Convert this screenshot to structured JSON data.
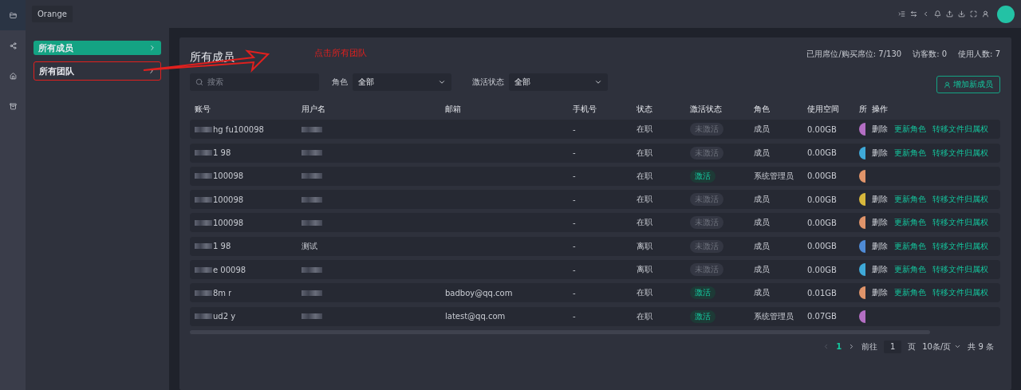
{
  "topbar": {
    "workspace": "Orange"
  },
  "sidebar": {
    "items": [
      {
        "label": "所有成员",
        "selected": true
      },
      {
        "label": "所有团队",
        "selected": false
      }
    ]
  },
  "annotation": {
    "text": "点击所有团队"
  },
  "panel": {
    "title": "所有成员",
    "stats": [
      "已用席位/购买席位: 7/130",
      "访客数: 0",
      "使用人数: 7"
    ],
    "filters": {
      "search_placeholder": "搜索",
      "role_label": "角色",
      "role_value": "全部",
      "activation_label": "激活状态",
      "activation_value": "全部"
    },
    "add_button": "增加新成员"
  },
  "table": {
    "columns": [
      "账号",
      "用户名",
      "邮箱",
      "手机号",
      "状态",
      "激活状态",
      "角色",
      "使用空间",
      "所",
      "操作"
    ],
    "rows": [
      {
        "account": "hg fu100098",
        "username": "",
        "email": "",
        "phone": "-",
        "status": "在职",
        "activation": "未激活",
        "activated": false,
        "role": "成员",
        "space": "0.00GB",
        "color": "#b46fc4",
        "actions": [
          "删除",
          "更新角色",
          "转移文件归属权"
        ]
      },
      {
        "account": "1 98",
        "username": "",
        "email": "",
        "phone": "-",
        "status": "在职",
        "activation": "未激活",
        "activated": false,
        "role": "成员",
        "space": "0.00GB",
        "color": "#3fa9d8",
        "actions": [
          "删除",
          "更新角色",
          "转移文件归属权"
        ]
      },
      {
        "account": "100098",
        "username": "",
        "email": "",
        "phone": "-",
        "status": "在职",
        "activation": "激活",
        "activated": true,
        "role": "系统管理员",
        "space": "0.00GB",
        "color": "#e0946a"
      },
      {
        "account": "100098",
        "username": "",
        "email": "",
        "phone": "-",
        "status": "在职",
        "activation": "未激活",
        "activated": false,
        "role": "成员",
        "space": "0.00GB",
        "color": "#d8b83c",
        "actions": [
          "删除",
          "更新角色",
          "转移文件归属权"
        ]
      },
      {
        "account": "100098",
        "username": "",
        "email": "",
        "phone": "-",
        "status": "在职",
        "activation": "未激活",
        "activated": false,
        "role": "成员",
        "space": "0.00GB",
        "color": "#e0946a",
        "actions": [
          "删除",
          "更新角色",
          "转移文件归属权"
        ]
      },
      {
        "account": "1 98",
        "username": "测试",
        "email": "",
        "phone": "-",
        "status": "离职",
        "activation": "未激活",
        "activated": false,
        "role": "成员",
        "space": "0.00GB",
        "color": "#4f8bd6",
        "actions": [
          "删除",
          "更新角色",
          "转移文件归属权"
        ]
      },
      {
        "account": "e 00098",
        "username": "",
        "email": "",
        "phone": "-",
        "status": "离职",
        "activation": "未激活",
        "activated": false,
        "role": "成员",
        "space": "0.00GB",
        "color": "#3fa9d8",
        "actions": [
          "删除",
          "更新角色",
          "转移文件归属权"
        ]
      },
      {
        "account": "8m r",
        "username": "",
        "email": "badboy@qq.com",
        "phone": "-",
        "status": "在职",
        "activation": "激活",
        "activated": true,
        "role": "成员",
        "space": "0.01GB",
        "color": "#e0946a",
        "actions": [
          "删除",
          "更新角色",
          "转移文件归属权"
        ]
      },
      {
        "account": "ud2 y",
        "username": "",
        "email": "latest@qq.com",
        "phone": "-",
        "status": "在职",
        "activation": "激活",
        "activated": true,
        "role": "系统管理员",
        "space": "0.07GB",
        "color": "#b46fc4"
      }
    ]
  },
  "pagination": {
    "current": "1",
    "goto_label": "前往",
    "goto_value": "1",
    "page_unit": "页",
    "page_size": "10条/页",
    "total": "共 9 条"
  }
}
